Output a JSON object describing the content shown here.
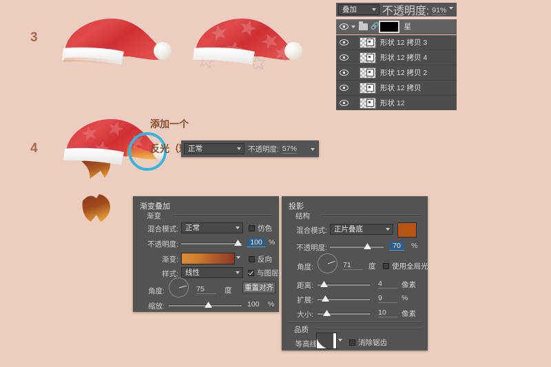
{
  "page": {
    "background_color": "#eccdc0",
    "accent_highlight_color": "#39b2dd",
    "annotation_color": "#8a4a2a"
  },
  "steps": [
    {
      "number": "3"
    },
    {
      "number": "4"
    }
  ],
  "annotation": {
    "line1": "添加一个",
    "line2": "反光（环境色）"
  },
  "illustrations": {
    "hat_plain": {
      "name": "santa-hat-plain"
    },
    "hat_stars": {
      "name": "santa-hat-stars"
    },
    "hat_highlight": {
      "name": "santa-hat-with-reflection"
    },
    "shadow_shape": {
      "name": "brown-gradient-shape"
    }
  },
  "layers_panel": {
    "blend_mode": "叠加",
    "opacity_label": "不透明度:",
    "opacity_value": "91%",
    "group": {
      "name": "星",
      "visible": true
    },
    "layers": [
      {
        "name": "形状 12 拷贝 3",
        "visible": true
      },
      {
        "name": "形状 12 拷贝 4",
        "visible": true
      },
      {
        "name": "形状 12 拷贝 2",
        "visible": true
      },
      {
        "name": "形状 12 拷贝",
        "visible": true
      },
      {
        "name": "形状 12",
        "visible": true
      }
    ]
  },
  "layer_bar": {
    "blend_mode": "正常",
    "opacity_label": "不透明度:",
    "opacity_value": "57%"
  },
  "gradient_overlay": {
    "title": "渐变叠加",
    "subtitle": "渐变",
    "blend_mode_label": "混合模式:",
    "blend_mode_value": "正常",
    "dither_label": "仿色",
    "dither_checked": false,
    "opacity_label": "不透明度:",
    "opacity_value": "100",
    "opacity_unit": "%",
    "gradient_label": "渐变:",
    "gradient_from": "#dd8b34",
    "gradient_to": "#8e3a26",
    "reverse_label": "反向",
    "reverse_checked": false,
    "style_label": "样式:",
    "style_value": "线性",
    "align_label": "与图层对齐",
    "align_checked": true,
    "angle_label": "角度:",
    "angle_value": "75",
    "angle_unit": "度",
    "reset_align_label": "重置对齐",
    "scale_label": "缩放:",
    "scale_value": "100",
    "scale_unit": "%"
  },
  "drop_shadow": {
    "title": "投影",
    "subtitle": "结构",
    "blend_mode_label": "混合模式:",
    "blend_mode_value": "正片叠底",
    "shadow_color": "#b35511",
    "opacity_label": "不透明度:",
    "opacity_value": "70",
    "opacity_unit": "%",
    "angle_label": "角度:",
    "angle_value": "71",
    "angle_unit": "度",
    "global_light_label": "使用全局光",
    "global_light_checked": false,
    "distance_label": "距离:",
    "distance_value": "4",
    "distance_unit": "像素",
    "spread_label": "扩展:",
    "spread_value": "9",
    "spread_unit": "%",
    "size_label": "大小:",
    "size_value": "10",
    "size_unit": "像素",
    "quality_title": "品质",
    "contour_label": "等高线:",
    "antialias_label": "消除锯齿",
    "antialias_checked": false
  }
}
